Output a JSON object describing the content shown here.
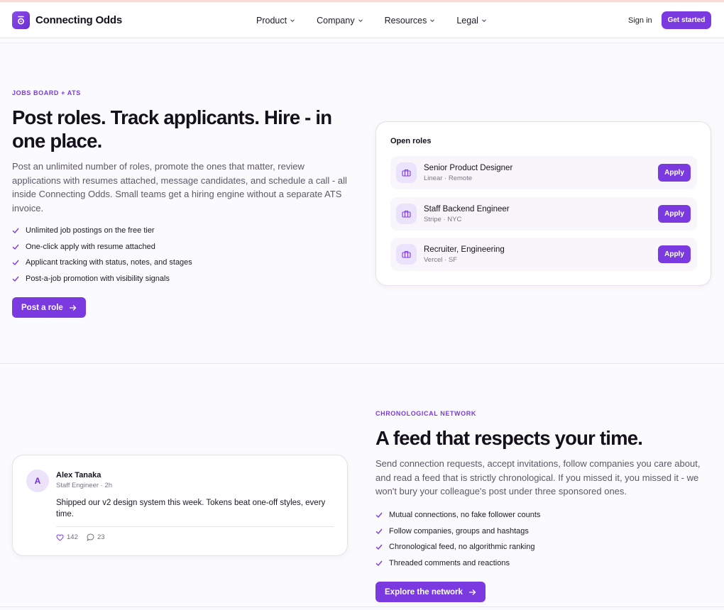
{
  "nav": {
    "brand": "Connecting Odds",
    "menu": [
      "Product",
      "Company",
      "Resources",
      "Legal"
    ],
    "sign_in": "Sign in",
    "get_started": "Get started"
  },
  "jobs": {
    "eyebrow": "JOBS BOARD + ATS",
    "title": "Post roles. Track applicants. Hire - in one place.",
    "lead": "Post an unlimited number of roles, promote the ones that matter, review applications with resumes attached, message candidates, and schedule a call - all inside Connecting Odds. Small teams get a hiring engine without a separate ATS invoice.",
    "checks": [
      "Unlimited job postings on the free tier",
      "One-click apply with resume attached",
      "Applicant tracking with status, notes, and stages",
      "Post-a-job promotion with visibility signals"
    ],
    "cta": "Post a role",
    "card": {
      "title": "Open roles",
      "roles": [
        {
          "title": "Senior Product Designer",
          "meta": "Linear · Remote",
          "action": "Apply"
        },
        {
          "title": "Staff Backend Engineer",
          "meta": "Stripe · NYC",
          "action": "Apply"
        },
        {
          "title": "Recruiter, Engineering",
          "meta": "Vercel · SF",
          "action": "Apply"
        }
      ]
    }
  },
  "network": {
    "eyebrow": "CHRONOLOGICAL NETWORK",
    "title": "A feed that respects your time.",
    "lead": "Send connection requests, accept invitations, follow companies you care about, and read a feed that is strictly chronological. If you missed it, you missed it - we won't bury your colleague's post under three sponsored ones.",
    "checks": [
      "Mutual connections, no fake follower counts",
      "Follow companies, groups and hashtags",
      "Chronological feed, no algorithmic ranking",
      "Threaded comments and reactions"
    ],
    "cta": "Explore the network",
    "post": {
      "avatar": "A",
      "author": "Alex Tanaka",
      "meta": "Staff Engineer · 2h",
      "text": "Shipped our v2 design system this week. Tokens beat one-off styles, every time.",
      "likes": "142",
      "comments": "23"
    }
  },
  "colors": {
    "accent": "#7b3ae0",
    "text": "#14111c",
    "muted": "#5d5868"
  }
}
